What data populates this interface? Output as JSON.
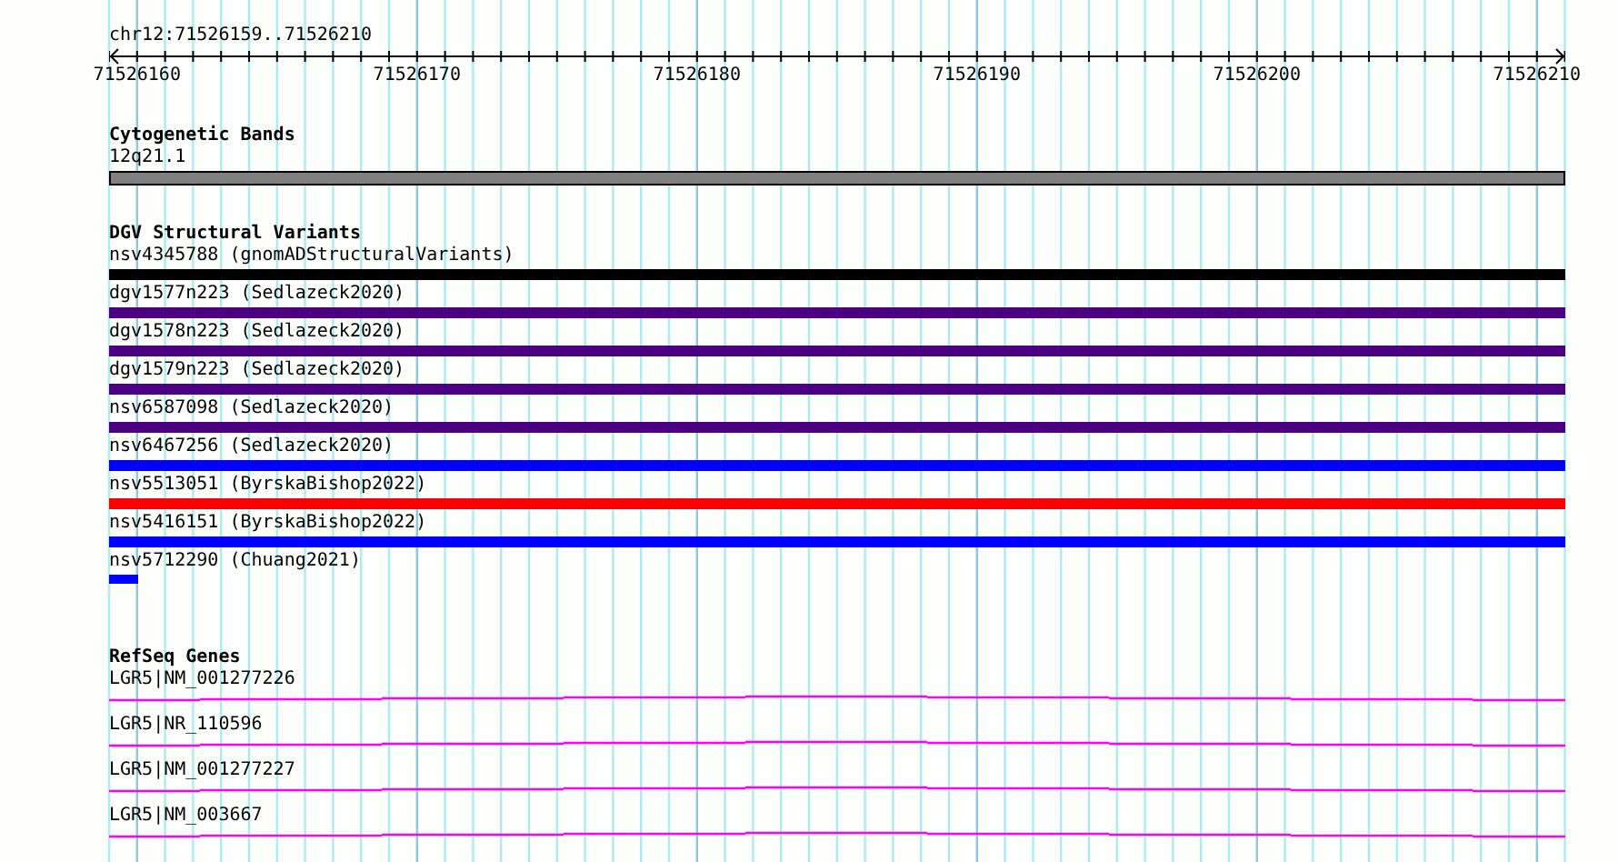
{
  "ruler": {
    "location": "chr12:71526159..71526210",
    "ticks": [
      "71526160",
      "71526170",
      "71526180",
      "71526190",
      "71526200",
      "71526210"
    ]
  },
  "tracks": [
    {
      "kind": "band",
      "title": "Cytogenetic Bands",
      "features": [
        {
          "label": "12q21.1"
        }
      ]
    },
    {
      "kind": "variant",
      "title": "DGV Structural Variants",
      "features": [
        {
          "label": "nsv4345788 (gnomADStructuralVariants)",
          "color": "#000000",
          "kind": "full"
        },
        {
          "label": "dgv1577n223 (Sedlazeck2020)",
          "color": "#4b0082",
          "kind": "full"
        },
        {
          "label": "dgv1578n223 (Sedlazeck2020)",
          "color": "#4b0082",
          "kind": "full"
        },
        {
          "label": "dgv1579n223 (Sedlazeck2020)",
          "color": "#4b0082",
          "kind": "full"
        },
        {
          "label": "nsv6587098 (Sedlazeck2020)",
          "color": "#4b0082",
          "kind": "full"
        },
        {
          "label": "nsv6467256 (Sedlazeck2020)",
          "color": "#0000ff",
          "kind": "full"
        },
        {
          "label": "nsv5513051 (ByrskaBishop2022)",
          "color": "#ff0000",
          "kind": "full"
        },
        {
          "label": "nsv5416151 (ByrskaBishop2022)",
          "color": "#0000ff",
          "kind": "full"
        },
        {
          "label": "nsv5712290 (Chuang2021)",
          "color": "#0000ff",
          "kind": "short"
        }
      ]
    },
    {
      "kind": "gene",
      "title": "RefSeq Genes",
      "features": [
        {
          "label": "LGR5|NM_001277226"
        },
        {
          "label": "LGR5|NR_110596"
        },
        {
          "label": "LGR5|NM_001277227"
        },
        {
          "label": "LGR5|NM_003667"
        }
      ]
    }
  ]
}
